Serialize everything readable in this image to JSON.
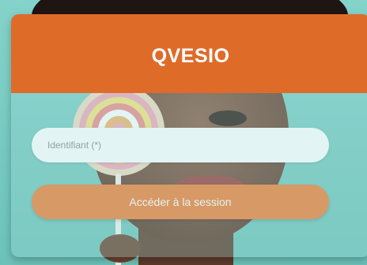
{
  "login": {
    "title": "QVESIO",
    "identifier_placeholder": "Identifiant (*)",
    "identifier_value": "",
    "submit_label": "Accéder à la session"
  },
  "colors": {
    "header": "#df6b29",
    "button": "#ef7d35",
    "background": "#7ccfc7",
    "text_light": "#ffffff"
  }
}
